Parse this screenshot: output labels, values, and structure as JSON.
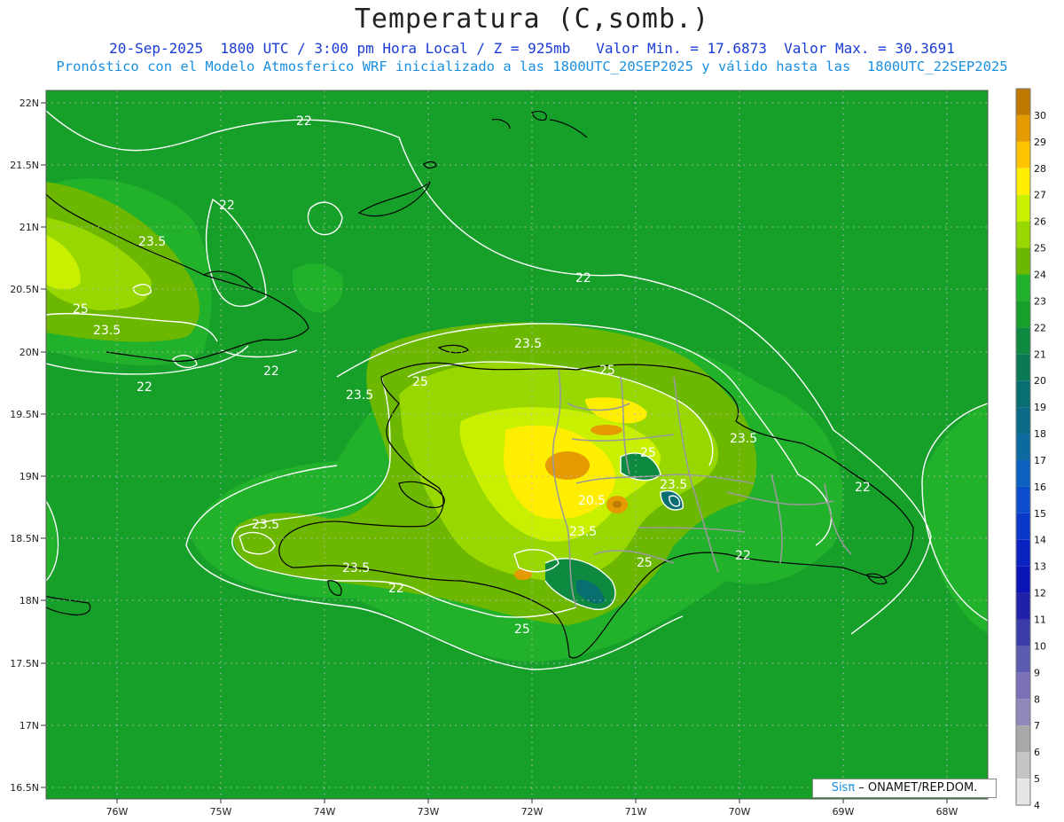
{
  "title": "Temperatura (C,somb.)",
  "subtitle_line1": "20-Sep-2025  1800 UTC / 3:00 pm Hora Local / Z = 925mb   Valor Min. = 17.6873  Valor Max. = 30.3691",
  "subtitle_line2": "Pronóstico con el Modelo Atmosferico WRF inicializado a las 1800UTC_20SEP2025 y válido hasta las  1800UTC_22SEP2025",
  "map": {
    "lon_range": [
      -76.65,
      -67.55
    ],
    "lat_range": [
      16.4,
      22.1
    ],
    "lat_ticks": [
      "22N",
      "21.5N",
      "21N",
      "20.5N",
      "20N",
      "19.5N",
      "19N",
      "18.5N",
      "18N",
      "17.5N",
      "17N",
      "16.5N"
    ],
    "lon_ticks": [
      "76W",
      "75W",
      "74W",
      "73W",
      "72W",
      "71W",
      "70W",
      "69W",
      "68W"
    ],
    "contour_labels": [
      "22",
      "22",
      "22",
      "22",
      "22",
      "22",
      "22",
      "22",
      "23.5",
      "23.5",
      "23.5",
      "23.5",
      "23.5",
      "23.5",
      "23.5",
      "23.5",
      "23.5",
      "25",
      "25",
      "25",
      "25",
      "25",
      "25",
      "20.5"
    ]
  },
  "colorbar": {
    "levels": [
      "30",
      "29",
      "28",
      "27",
      "26",
      "25",
      "24",
      "23",
      "22",
      "21",
      "20",
      "19",
      "18",
      "17",
      "16",
      "15",
      "14",
      "13",
      "12",
      "11",
      "10",
      "9",
      "8",
      "7",
      "6",
      "5",
      "4"
    ],
    "colors": [
      "#c07a00",
      "#e49a00",
      "#ffc400",
      "#ffee00",
      "#c8f000",
      "#98d800",
      "#6cb800",
      "#22b12a",
      "#16a02a",
      "#0d8a40",
      "#0a7a55",
      "#096e70",
      "#0b6a86",
      "#0c6aa0",
      "#0c60c0",
      "#0b4ccc",
      "#0a38c8",
      "#0a22c2",
      "#0a14b6",
      "#2020a8",
      "#3a3aa8",
      "#5c5cb0",
      "#7a70b8",
      "#9088b8",
      "#a8a8a8",
      "#c4c4c4",
      "#e6e6e6"
    ]
  },
  "credit": {
    "brand": "Sisπ",
    "text": " – ONAMET/REP.DOM."
  }
}
